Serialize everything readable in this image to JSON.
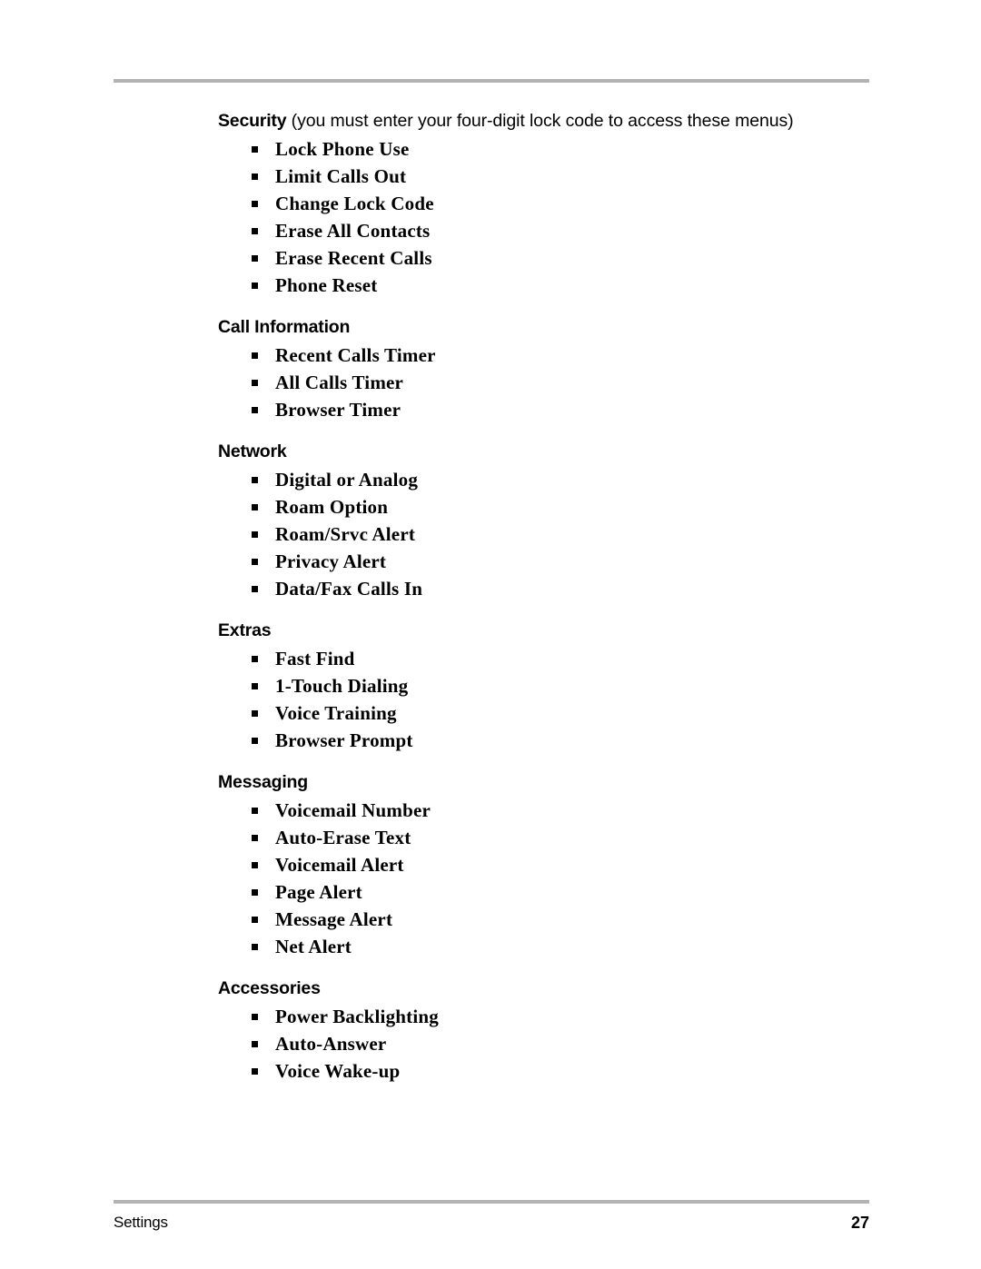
{
  "page": {
    "background_color": "#ffffff",
    "rule_color": "#b3b3b3",
    "text_color": "#000000"
  },
  "sections": [
    {
      "heading": "Security",
      "heading_note": " (you must enter your four-digit lock code to access these menus)",
      "items": [
        "Lock Phone Use",
        "Limit Calls Out",
        "Change Lock Code",
        "Erase All Contacts",
        "Erase Recent Calls",
        "Phone Reset"
      ]
    },
    {
      "heading": "Call Information",
      "heading_note": "",
      "items": [
        "Recent Calls Timer",
        "All Calls Timer",
        "Browser Timer"
      ]
    },
    {
      "heading": "Network",
      "heading_note": "",
      "items": [
        "Digital or Analog",
        "Roam Option",
        "Roam/Srvc Alert",
        "Privacy Alert",
        "Data/Fax Calls In"
      ]
    },
    {
      "heading": "Extras",
      "heading_note": "",
      "items": [
        "Fast Find",
        "1-Touch Dialing",
        "Voice Training",
        "Browser Prompt"
      ]
    },
    {
      "heading": "Messaging",
      "heading_note": "",
      "items": [
        "Voicemail Number",
        "Auto-Erase Text",
        "Voicemail Alert",
        "Page Alert",
        "Message Alert",
        "Net Alert"
      ]
    },
    {
      "heading": "Accessories",
      "heading_note": "",
      "items": [
        "Power Backlighting",
        "Auto-Answer",
        "Voice Wake-up"
      ]
    }
  ],
  "footer": {
    "label": "Settings",
    "page_number": "27"
  }
}
